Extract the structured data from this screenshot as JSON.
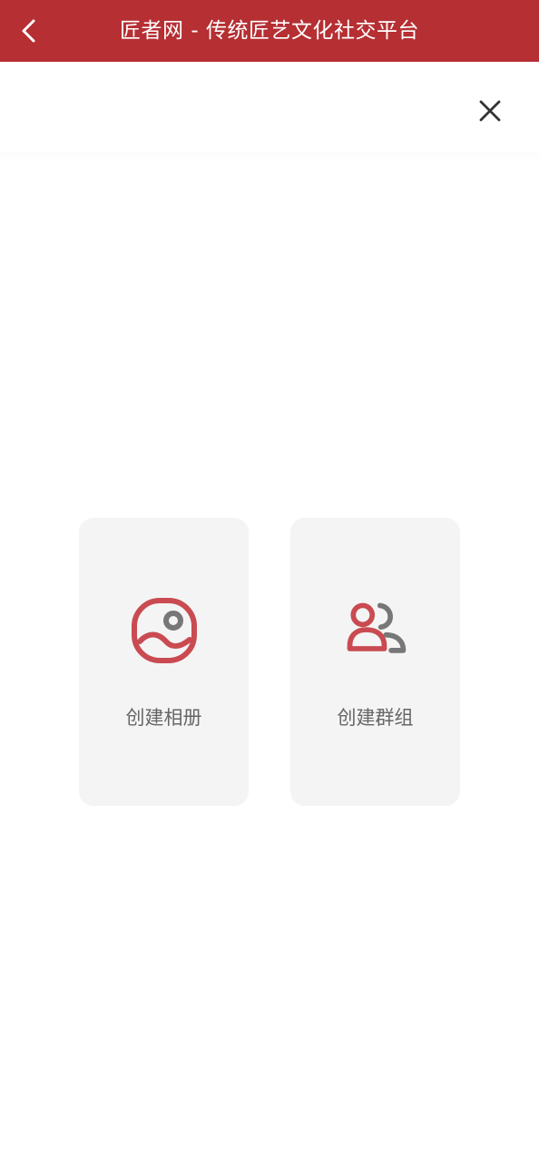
{
  "header": {
    "title": "匠者网 - 传统匠艺文化社交平台",
    "back_icon": "chevron-left-icon",
    "background_color": "#b52f33"
  },
  "overlay": {
    "close_icon": "close-icon"
  },
  "actions": [
    {
      "label": "创建相册",
      "icon": "album-icon",
      "accent_color": "#c94b51"
    },
    {
      "label": "创建群组",
      "icon": "group-icon",
      "accent_color": "#c94b51",
      "secondary_color": "#777777"
    }
  ]
}
